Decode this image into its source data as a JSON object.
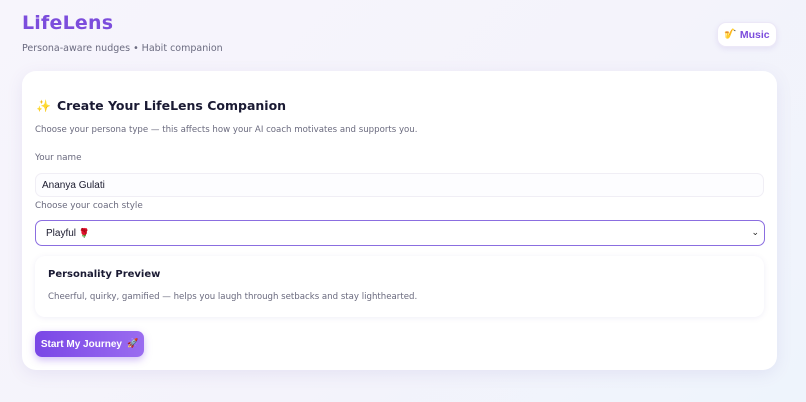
{
  "header": {
    "title": "LifeLens",
    "subtitle": "Persona-aware nudges • Habit companion",
    "music_button": {
      "label": "Music",
      "icon": "saxophone-icon"
    }
  },
  "onboarding": {
    "title": "Create Your LifeLens Companion",
    "title_icon": "sparkles-icon",
    "description": "Choose your persona type — this affects how your AI coach motivates and supports you.",
    "name_label": "Your name",
    "name_value": "Ananya Gulati",
    "style_label": "Choose your coach style",
    "style_value": "Playful",
    "style_value_icon": "rose-icon",
    "preview": {
      "title": "Personality Preview",
      "description": "Cheerful, quirky, gamified — helps you laugh through setbacks and stay lighthearted."
    },
    "start_button": {
      "label": "Start My Journey",
      "icon": "rocket-icon"
    }
  },
  "colors": {
    "accent": "#7c4ddc",
    "button_gradient_start": "#7a47e6",
    "button_gradient_end": "#9a6cf0",
    "select_border": "#8b6ee0"
  }
}
